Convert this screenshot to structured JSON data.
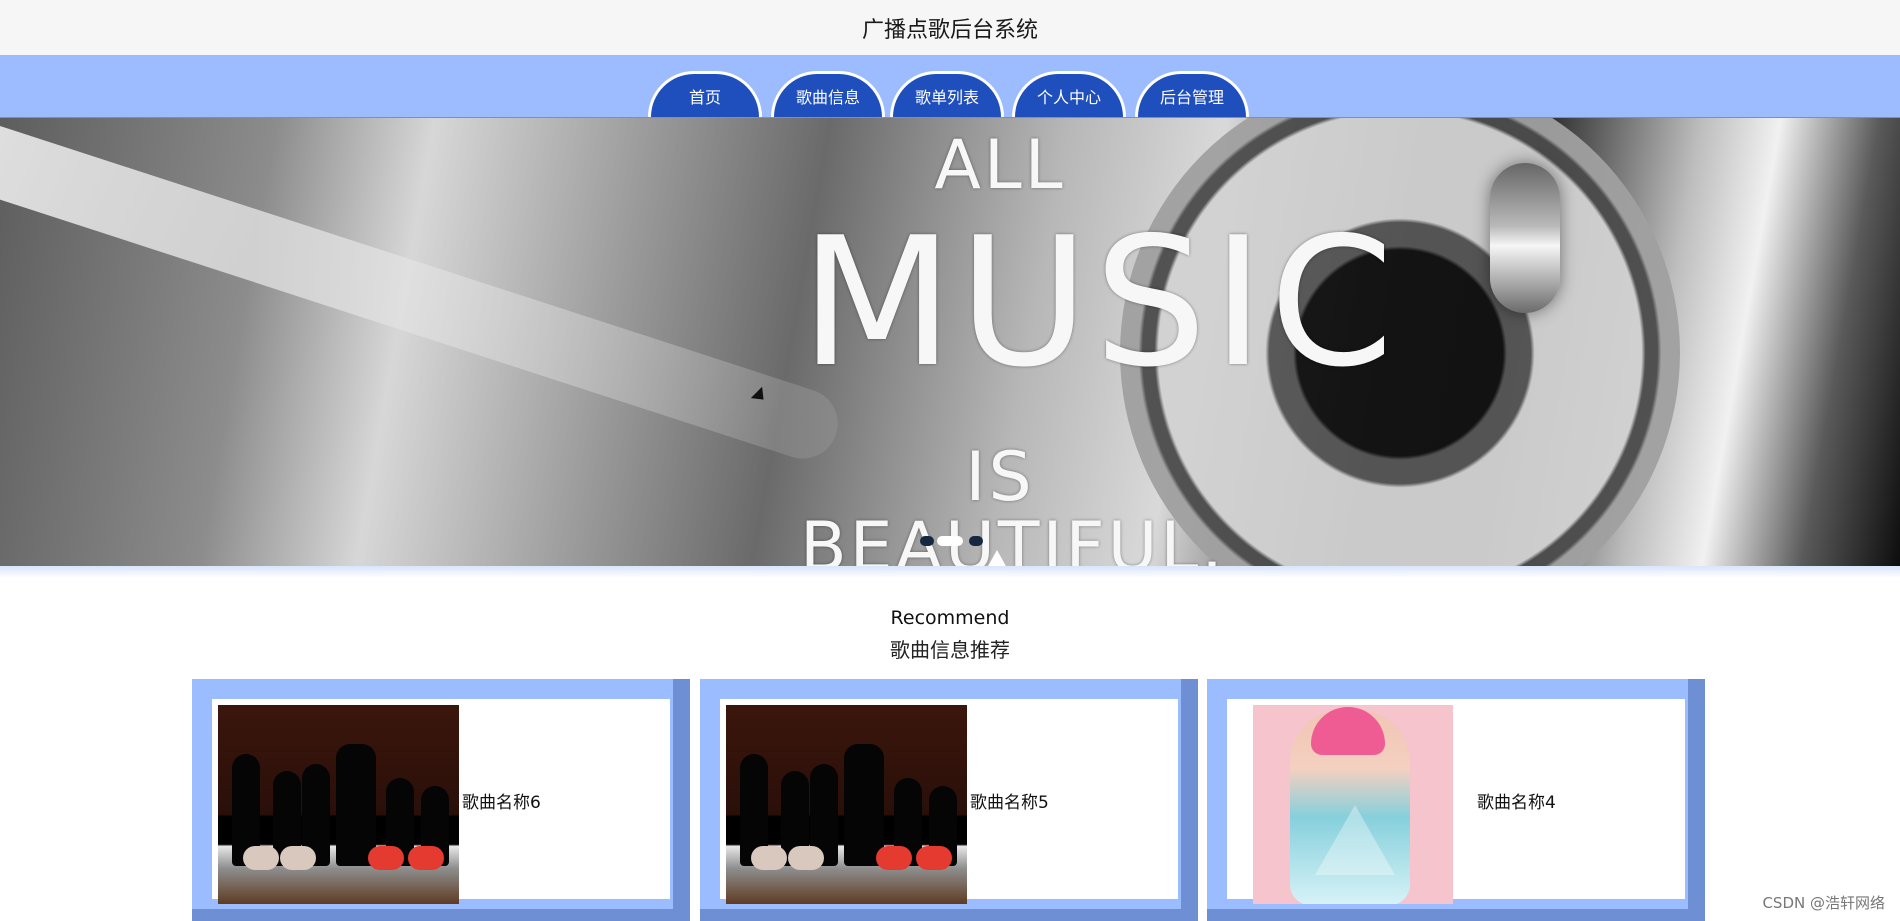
{
  "header": {
    "title": "广播点歌后台系统"
  },
  "nav": {
    "items": [
      {
        "label": "首页"
      },
      {
        "label": "歌曲信息"
      },
      {
        "label": "歌单列表"
      },
      {
        "label": "个人中心"
      },
      {
        "label": "后台管理"
      }
    ]
  },
  "banner": {
    "line1": "ALL",
    "line2": "MUSIC",
    "line3": "IS BEAUTIFUL.",
    "active_slide": 2
  },
  "recommend": {
    "title_en": "Recommend",
    "title_cn": "歌曲信息推荐",
    "songs": [
      {
        "name": "歌曲名称6"
      },
      {
        "name": "歌曲名称5"
      },
      {
        "name": "歌曲名称4"
      }
    ]
  },
  "watermark": {
    "text": "CSDN @浩轩网络"
  },
  "colors": {
    "nav_bar": "#9dbcff",
    "nav_tab": "#1f4fbd",
    "card_border": "#9bbcff",
    "card_shadow": "#6f8fd5"
  }
}
